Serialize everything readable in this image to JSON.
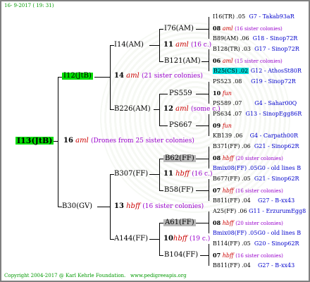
{
  "header": {
    "date": "16-  9-2017  ( 19: 31)"
  },
  "footer": {
    "copyright": "Copyright 2004-2017 @ Karl Kehrle Foundation.",
    "url": "www.pedigreeapis.org"
  },
  "root": {
    "name": "I13(JtB)",
    "num": "16",
    "aml": "aml",
    "note": "(Drones from 25 sister colonies)"
  },
  "l1": [
    {
      "name": "I12(JtB)",
      "num": "14",
      "aml": "aml",
      "note": "(21 sister colonies)"
    },
    {
      "name": "B30(GV)",
      "num": "13",
      "aml": "hbff",
      "note": "(16 sister colonies)"
    }
  ],
  "l2": [
    {
      "name": "I14(AM)"
    },
    {
      "name": "B226(AM)",
      "num": "12",
      "aml": "aml",
      "note": "(some c.)"
    },
    {
      "name": "B307(FF)"
    },
    {
      "name": "A144(FF)",
      "num": "10",
      "aml": "hbff",
      "note": "(19 c.)"
    }
  ],
  "l3": [
    {
      "name": "I76(AM)",
      "num": "11",
      "aml": "aml",
      "note": "(16 c.)"
    },
    {
      "name": "B121(AM)"
    },
    {
      "name": "PS559"
    },
    {
      "name": "PS667"
    },
    {
      "name": "B62(FF)",
      "num": "11",
      "aml": "hbff",
      "note": "(16 c.)"
    },
    {
      "name": "B58(FF)"
    },
    {
      "name": "A61(FF)"
    },
    {
      "name": "B104(FF)"
    }
  ],
  "l4": [
    {
      "a": "I16(TR) .05",
      "al": "G7 - Takab93aR",
      "n": "08",
      "m": "aml",
      "c": "(16 sister colonies)",
      "b": "B89(AM) .06",
      "bl": "G18 - Sinop72R"
    },
    {
      "a": "B128(TR) .03",
      "al": "G17 - Sinop72R",
      "n": "06",
      "m": "aml",
      "c": "(15 sister colonies)",
      "b": "B25(CS) .02",
      "bl": "G12 - AthosSt80R"
    },
    {
      "a": "PS523 .08",
      "al": "G19 - Sinop72R",
      "n": "10",
      "m": "fun",
      "c": "",
      "b": "PS589 .07",
      "bl": "G4 - Sahar00Q"
    },
    {
      "a": "PS634 .07",
      "al": "G13 - SinopEgg86R",
      "n": "09",
      "m": "fun",
      "c": "",
      "b": "KB139 .06",
      "bl": "G4 - Carpath00R"
    },
    {
      "a": "B371(FF) .06",
      "al": "G21 - Sinop62R",
      "n": "08",
      "m": "hbff",
      "c": "(20 sister colonies)",
      "b": "Bmix08(FF) .05G0 - old lines B",
      "bl": ""
    },
    {
      "a": "B677(FF) .05",
      "al": "G21 - Sinop62R",
      "n": "07",
      "m": "hbff",
      "c": "(16 sister colonies)",
      "b": "B811(FF) .04",
      "bl": "G27 - B-xx43"
    },
    {
      "a": "A25(FF) .06",
      "al": "G11 - ErzurumEgg8",
      "n": "08",
      "m": "hbff",
      "c": "(20 sister colonies)",
      "b": "Bmix08(FF) .05G0 - old lines B",
      "bl": ""
    },
    {
      "a": "B114(FF) .05",
      "al": "G20 - Sinop62R",
      "n": "07",
      "m": "hbff",
      "c": "(16 sister colonies)",
      "b": "B811(FF) .04",
      "bl": "G27 - B-xx43"
    }
  ]
}
